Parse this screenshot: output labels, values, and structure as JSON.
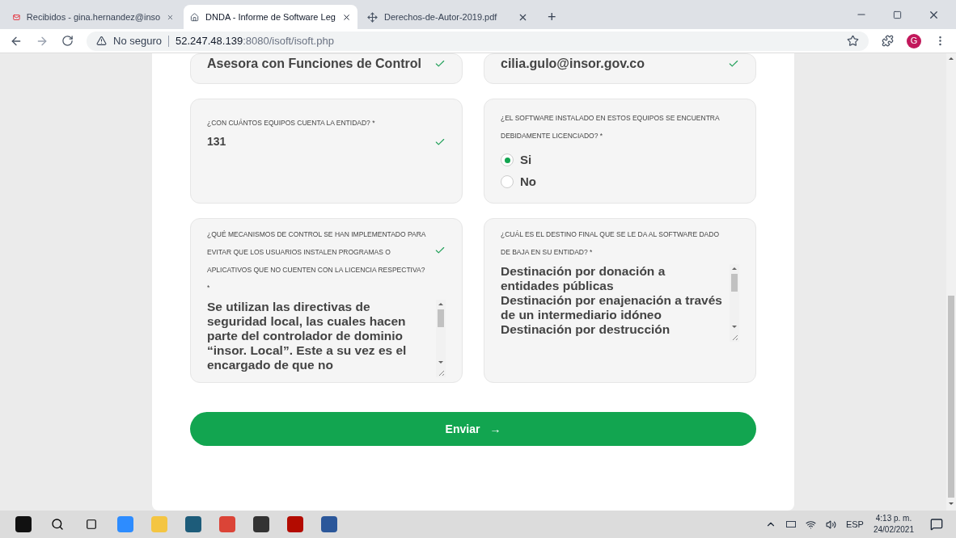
{
  "browser": {
    "tabs": [
      {
        "title": "Recibidos - gina.hernandez@inso",
        "kind": "mail",
        "selected": false
      },
      {
        "title": "DNDA - Informe de Software Leg",
        "kind": "home",
        "selected": true
      },
      {
        "title": "Derechos-de-Autor-2019.pdf",
        "kind": "pdf",
        "selected": false
      }
    ],
    "new_tab": "+",
    "security": "No seguro",
    "url_host": "52.247.48.139",
    "url_path": ":8080/isoft/isoft.php",
    "profile": "G"
  },
  "form": {
    "fields": [
      {
        "kind": "text",
        "value": "Asesora con Funciones de Control",
        "valid": true
      },
      {
        "kind": "text",
        "value": "cilia.gulo@insor.gov.co",
        "valid": true
      },
      {
        "kind": "text",
        "label": "¿CON CUÁNTOS EQUIPOS CUENTA LA ENTIDAD? *",
        "value": "131",
        "valid": true
      },
      {
        "kind": "radio",
        "label": "¿EL SOFTWARE INSTALADO EN ESTOS EQUIPOS SE ENCUENTRA DEBIDAMENTE LICENCIADO? *",
        "options": [
          {
            "label": "Si",
            "selected": true
          },
          {
            "label": "No",
            "selected": false
          }
        ]
      },
      {
        "kind": "textarea",
        "label": "¿QUÉ MECANISMOS DE CONTROL SE HAN IMPLEMENTADO PARA EVITAR QUE LOS USUARIOS INSTALEN PROGRAMAS O APLICATIVOS QUE NO CUENTEN CON LA LICENCIA RESPECTIVA? *",
        "value": "Se utilizan las directivas de seguridad local, las cuales hacen parte del controlador de dominio “insor. Local”. Este a su vez es el encargado de que no",
        "valid": true
      },
      {
        "kind": "textarea",
        "label": "¿CUÁL ES EL DESTINO FINAL QUE SE LE DA AL SOFTWARE DADO DE BAJA EN SU ENTIDAD? *",
        "value": "Destinación por donación a entidades públicas\nDestinación por enajenación a través de un intermediario idóneo\nDestinación por destrucción",
        "valid": false
      }
    ],
    "submit": {
      "label": "Enviar",
      "arrow": "→"
    }
  },
  "taskbar": {
    "language": "ESP",
    "time": "4:13 p. m.",
    "date": "24/02/2021"
  }
}
